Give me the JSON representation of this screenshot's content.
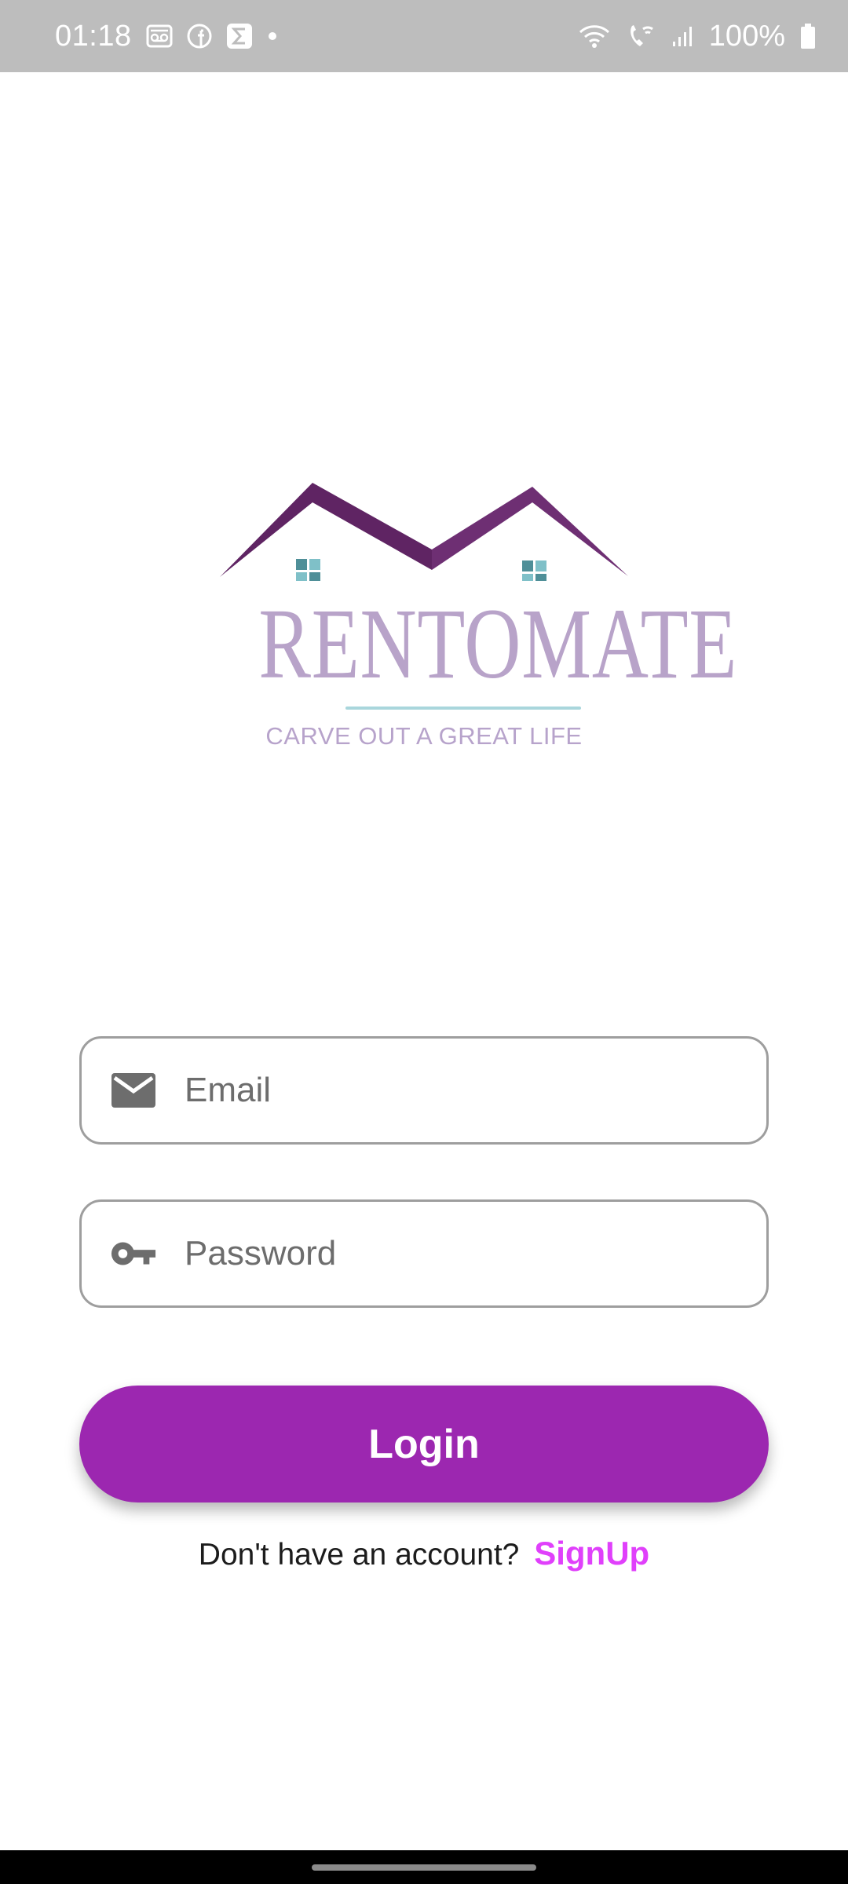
{
  "status_bar": {
    "time": "01:18",
    "battery_text": "100%",
    "left_icons": [
      "voicemail-icon",
      "facebook-icon",
      "sigma-icon",
      "dot-icon"
    ],
    "right_icons": [
      "wifi-icon",
      "wifi-calling-icon",
      "signal-icon",
      "battery-icon"
    ]
  },
  "logo": {
    "wordmark": "RENTOMATE",
    "tagline": "CARVE OUT A GREAT LIFE",
    "colors": {
      "roof_dark": "#5f2463",
      "roof_light": "#7b3a80",
      "window": "#5f9ea6",
      "wordmark": "#b8a3c9",
      "rule": "#a9d6dc"
    }
  },
  "form": {
    "email": {
      "placeholder": "Email",
      "value": "",
      "icon": "mail-icon"
    },
    "password": {
      "placeholder": "Password",
      "value": "",
      "icon": "key-icon"
    },
    "login_label": "Login",
    "signup_prompt": "Don't have an account?",
    "signup_label": "SignUp"
  },
  "colors": {
    "primary": "#9c27b0",
    "link": "#e040fb",
    "status_bar": "#bdbdbd",
    "field_border": "#9e9e9e"
  }
}
